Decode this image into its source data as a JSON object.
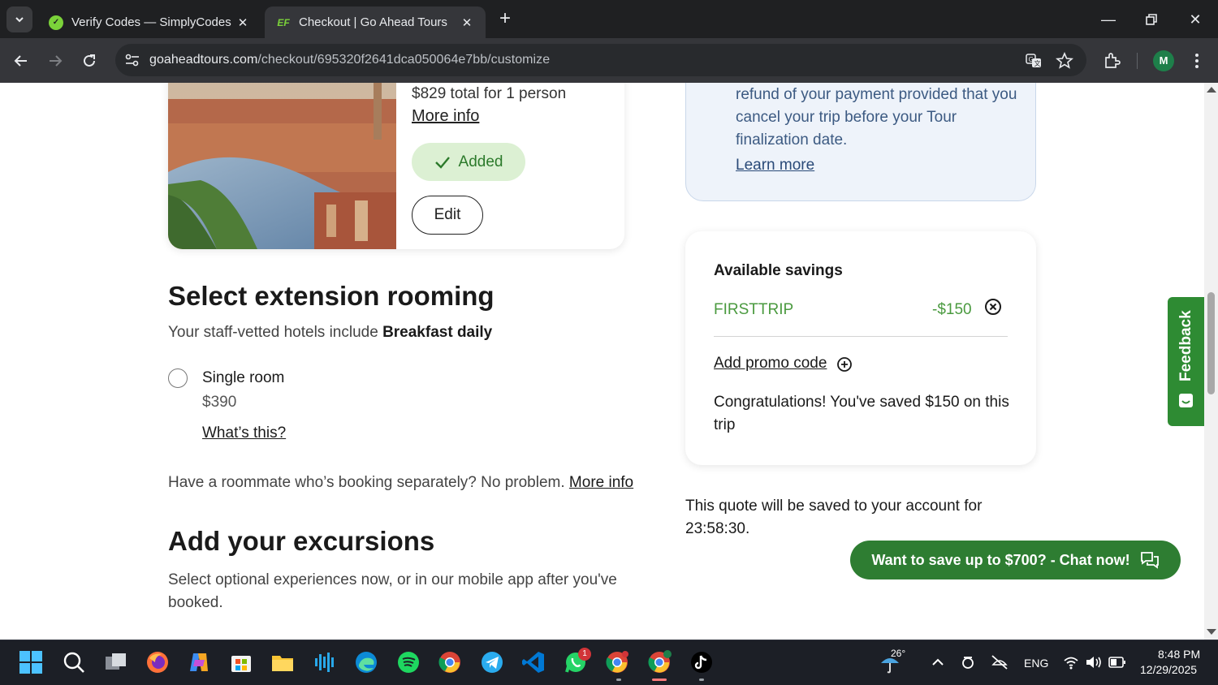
{
  "browser": {
    "tabs": [
      {
        "title": "Verify Codes — SimplyCodes",
        "active": false
      },
      {
        "title": "Checkout | Go Ahead Tours",
        "active": true
      }
    ],
    "url_host": "goaheadtours.com",
    "url_path": "/checkout/695320f2641dca050064e7bb/customize",
    "profile_initial": "M"
  },
  "product": {
    "price_line": "$829 total for 1 person",
    "more_info": "More info",
    "added_label": "Added",
    "edit_label": "Edit"
  },
  "rooming": {
    "heading": "Select extension rooming",
    "subtitle_prefix": "Your staff-vetted hotels include ",
    "subtitle_bold": "Breakfast daily",
    "option_label": "Single room",
    "option_price": "$390",
    "whats_this": "What’s this?",
    "roommate_text": "Have a roommate who’s booking separately? No problem. ",
    "roommate_link": "More info"
  },
  "excursions": {
    "heading": "Add your excursions",
    "text": "Select optional experiences now, or in our mobile app after you've booked."
  },
  "refund_info": {
    "text": "refund of your payment provided that you cancel your trip before your Tour finalization date.",
    "learn_more": "Learn more"
  },
  "savings": {
    "title": "Available savings",
    "promo_code": "FIRSTTRIP",
    "promo_amount": "-$150",
    "add_promo": "Add promo code",
    "congrats": "Congratulations! You've saved $150 on this trip"
  },
  "quote": {
    "text": "This quote will be saved to your account for 23:58:30."
  },
  "chat": {
    "label": "Want to save up to $700? - Chat now!"
  },
  "feedback": {
    "label": "Feedback"
  },
  "taskbar": {
    "weather_temp": "26°",
    "language": "ENG",
    "time": "8:48 PM",
    "date": "12/29/2025",
    "whatsapp_badge": "1"
  },
  "colors": {
    "brand_green": "#2e7d32",
    "promo_green": "#4a9a3f",
    "added_bg": "#dcf0d3",
    "info_bg": "#eef3fa"
  }
}
